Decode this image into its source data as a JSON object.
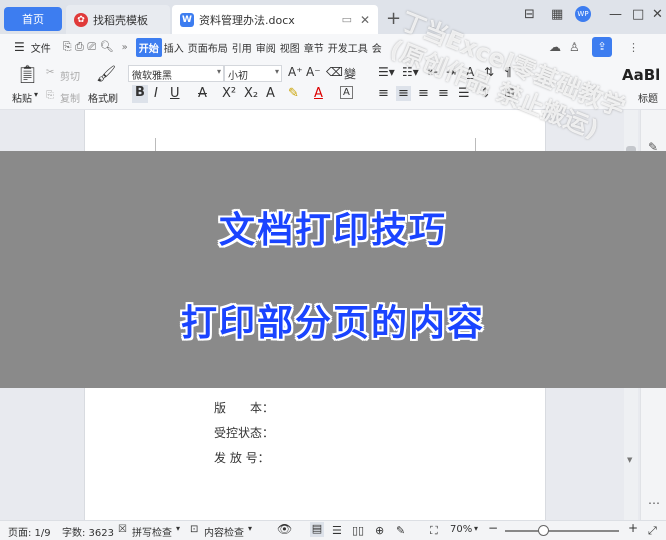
{
  "tabs": {
    "home": "首页",
    "template": "找稻壳模板",
    "doc": "资料管理办法.docx"
  },
  "menu": {
    "file": "文件",
    "items": [
      "开始",
      "插入",
      "页面布局",
      "引用",
      "审阅",
      "视图",
      "章节",
      "开发工具",
      "会"
    ]
  },
  "ribbon": {
    "paste": "粘贴",
    "cut": "剪切",
    "copy": "复制",
    "format_painter": "格式刷",
    "font_name": "微软雅黑",
    "font_size": "小初",
    "style_preview": "AaBl",
    "title_label": "标题"
  },
  "overlay": {
    "title1": "文档打印技巧",
    "title2": "打印部分页的内容"
  },
  "watermark": {
    "line1": "丁当Excel零基础教学",
    "line2": "(原创作品 禁止搬运)"
  },
  "document": {
    "lines": [
      "版　　本：",
      "受控状态：",
      "发 放 号："
    ]
  },
  "status": {
    "page": "页面: 1/9",
    "words": "字数: 3623",
    "spell": "拼写检查",
    "content_check": "内容检查",
    "zoom": "70%"
  }
}
